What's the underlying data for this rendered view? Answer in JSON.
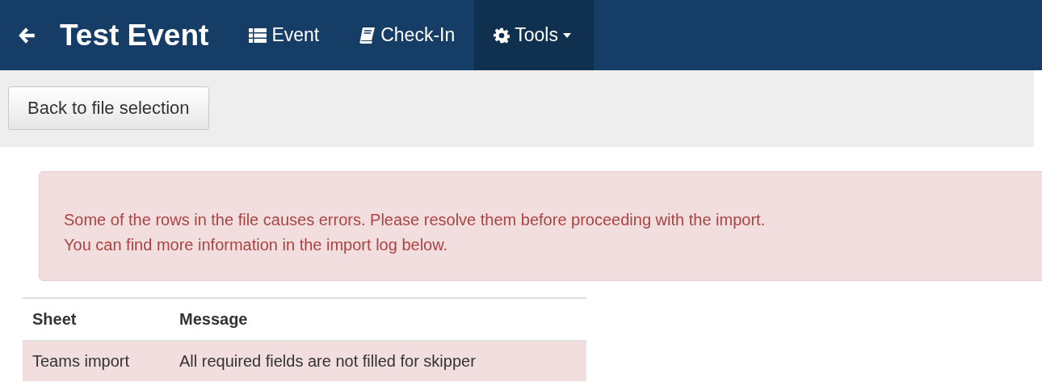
{
  "navbar": {
    "title": "Test Event",
    "items": [
      {
        "label": "Event",
        "kind": "list",
        "selected": false,
        "dropdown": false
      },
      {
        "label": "Check-In",
        "kind": "book",
        "selected": false,
        "dropdown": false
      },
      {
        "label": "Tools",
        "kind": "gear",
        "selected": true,
        "dropdown": true
      }
    ]
  },
  "toolbar": {
    "back_button": "Back to file selection"
  },
  "alert": {
    "lines": [
      "Some of the rows in the file causes errors. Please resolve them before proceeding with the import.",
      "You can find more information in the import log below."
    ]
  },
  "table": {
    "columns": [
      "Sheet",
      "Message"
    ],
    "rows": [
      {
        "cells": [
          "Teams import",
          "All required fields are not filled for skipper"
        ],
        "error": true
      }
    ]
  }
}
